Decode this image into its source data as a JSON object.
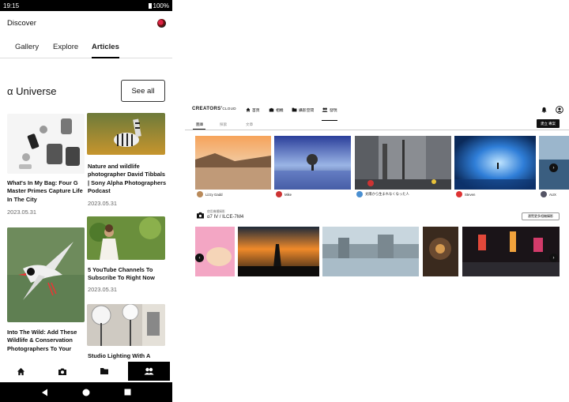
{
  "phone": {
    "status": {
      "time": "19:15",
      "battery": "100%"
    },
    "header": {
      "title": "Discover"
    },
    "tabs": [
      {
        "label": "Gallery",
        "active": false
      },
      {
        "label": "Explore",
        "active": false
      },
      {
        "label": "Articles",
        "active": true
      }
    ],
    "section": {
      "title": "α Universe",
      "see_all": "See all"
    },
    "articles": [
      {
        "title": "What's In My Bag: Four G Master Primes Capture Life In The City",
        "date": "2023.05.31"
      },
      {
        "title": "Nature and wildlife photographer David Tibbals | Sony Alpha Photographers Podcast",
        "date": "2023.05.31"
      },
      {
        "title": "5 YouTube Channels To Subscribe To Right Now",
        "date": "2023.05.31"
      },
      {
        "title": "Into The Wild: Add These Wildlife & Conservation Photographers To Your",
        "date": ""
      },
      {
        "title": "Studio Lighting With A",
        "date": ""
      }
    ],
    "bottom_nav": [
      {
        "icon": "home-icon",
        "active": false
      },
      {
        "icon": "camera-icon",
        "active": false
      },
      {
        "icon": "folder-icon",
        "active": false
      },
      {
        "icon": "people-icon",
        "active": true
      }
    ],
    "system_nav": [
      "back-icon",
      "home-circle-icon",
      "recents-icon"
    ]
  },
  "desktop": {
    "logo": "CREATORS'",
    "logo_suffix": "CLOUD",
    "nav": [
      {
        "icon": "home-icon",
        "label": "首頁"
      },
      {
        "icon": "camera-icon",
        "label": "相機"
      },
      {
        "icon": "folder-icon",
        "label": "攝影空間"
      },
      {
        "icon": "people-icon",
        "label": "發現"
      }
    ],
    "subtabs": [
      {
        "label": "圖庫",
        "active": true
      },
      {
        "label": "探索",
        "active": false
      },
      {
        "label": "文章",
        "active": false
      }
    ],
    "create_button": "建立 專案",
    "users": [
      "Lizzy Gadd",
      "Mike",
      "太陽から生まれなくなった人",
      "Steven",
      "AUX"
    ],
    "camera_section": {
      "small": "使用機種攝影",
      "title": "α7 IV / ILCE-7M4",
      "more": "瀏覽更多相機攝影"
    }
  },
  "colors": {
    "accent": "#000000",
    "nav_active_bg": "#000000"
  }
}
